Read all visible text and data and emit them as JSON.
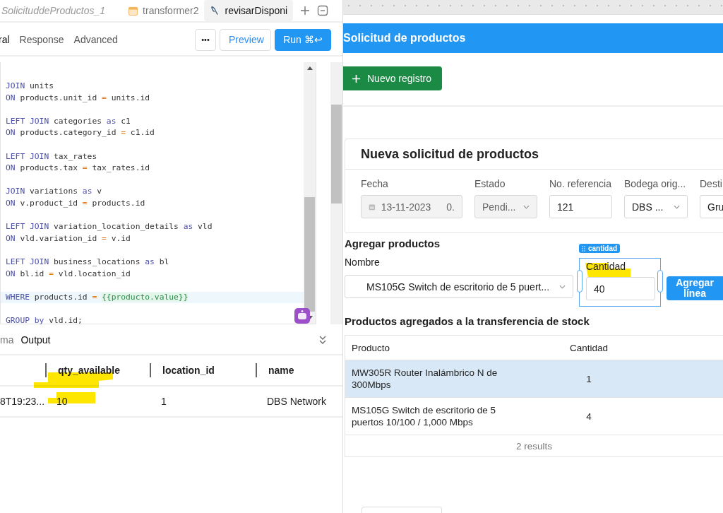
{
  "editor_tabs": [
    {
      "label": "SolicituddeProductos_1",
      "selected": false
    },
    {
      "label": "transformer2",
      "selected": false
    },
    {
      "label": "revisarDisponi",
      "selected": true
    }
  ],
  "query_tabs": [
    {
      "label": "ral",
      "selected": true
    },
    {
      "label": "Response",
      "selected": false
    },
    {
      "label": "Advanced",
      "selected": false
    }
  ],
  "toolbar": {
    "more": "•••",
    "preview": "Preview",
    "run": "Run ⌘↩"
  },
  "code": {
    "blocks": [
      {
        "lines": [
          {
            "highlighted": false,
            "tokens": [
              {
                "kind": "kw",
                "text": "JOIN"
              },
              {
                "kind": "id",
                "text": "units"
              }
            ]
          },
          {
            "highlighted": false,
            "tokens": [
              {
                "kind": "kw",
                "text": "ON"
              },
              {
                "kind": "id",
                "text": "products.unit_id"
              },
              {
                "kind": "op",
                "text": "="
              },
              {
                "kind": "id",
                "text": "units.id"
              }
            ]
          }
        ]
      },
      {
        "lines": [
          {
            "highlighted": false,
            "tokens": [
              {
                "kind": "kw",
                "text": "LEFT JOIN"
              },
              {
                "kind": "id",
                "text": "categories"
              },
              {
                "kind": "kw",
                "text": "as"
              },
              {
                "kind": "id",
                "text": "c1"
              }
            ]
          },
          {
            "highlighted": false,
            "tokens": [
              {
                "kind": "kw",
                "text": "ON"
              },
              {
                "kind": "id",
                "text": "products.category_id"
              },
              {
                "kind": "op",
                "text": "="
              },
              {
                "kind": "id",
                "text": "c1.id"
              }
            ]
          }
        ]
      },
      {
        "lines": [
          {
            "highlighted": false,
            "tokens": [
              {
                "kind": "kw",
                "text": "LEFT JOIN"
              },
              {
                "kind": "id",
                "text": "tax_rates"
              }
            ]
          },
          {
            "highlighted": false,
            "tokens": [
              {
                "kind": "kw",
                "text": "ON"
              },
              {
                "kind": "id",
                "text": "products.tax"
              },
              {
                "kind": "op",
                "text": "="
              },
              {
                "kind": "id",
                "text": "tax_rates.id"
              }
            ]
          }
        ]
      },
      {
        "lines": [
          {
            "highlighted": false,
            "tokens": [
              {
                "kind": "kw",
                "text": "JOIN"
              },
              {
                "kind": "id",
                "text": "variations"
              },
              {
                "kind": "kw",
                "text": "as"
              },
              {
                "kind": "id",
                "text": "v"
              }
            ]
          },
          {
            "highlighted": false,
            "tokens": [
              {
                "kind": "kw",
                "text": "ON"
              },
              {
                "kind": "id",
                "text": "v.product_id"
              },
              {
                "kind": "op",
                "text": "="
              },
              {
                "kind": "id",
                "text": "products.id"
              }
            ]
          }
        ]
      },
      {
        "lines": [
          {
            "highlighted": false,
            "tokens": [
              {
                "kind": "kw",
                "text": "LEFT JOIN"
              },
              {
                "kind": "id",
                "text": "variation_location_details"
              },
              {
                "kind": "kw",
                "text": "as"
              },
              {
                "kind": "id",
                "text": "vld"
              }
            ]
          },
          {
            "highlighted": false,
            "tokens": [
              {
                "kind": "kw",
                "text": "ON"
              },
              {
                "kind": "id",
                "text": "vld.variation_id"
              },
              {
                "kind": "op",
                "text": "="
              },
              {
                "kind": "id",
                "text": "v.id"
              }
            ]
          }
        ]
      },
      {
        "lines": [
          {
            "highlighted": false,
            "tokens": [
              {
                "kind": "kw",
                "text": "LEFT JOIN"
              },
              {
                "kind": "id",
                "text": "business_locations"
              },
              {
                "kind": "kw",
                "text": "as"
              },
              {
                "kind": "id",
                "text": "bl"
              }
            ]
          },
          {
            "highlighted": false,
            "tokens": [
              {
                "kind": "kw",
                "text": "ON"
              },
              {
                "kind": "id",
                "text": "bl.id"
              },
              {
                "kind": "op",
                "text": "="
              },
              {
                "kind": "id",
                "text": "vld.location_id"
              }
            ]
          }
        ]
      },
      {
        "lines": [
          {
            "highlighted": true,
            "tokens": [
              {
                "kind": "kw",
                "text": "WHERE"
              },
              {
                "kind": "id",
                "text": "products.id"
              },
              {
                "kind": "op",
                "text": "="
              },
              {
                "kind": "tpl",
                "text": "{{producto.value}}"
              }
            ]
          }
        ]
      },
      {
        "lines": [
          {
            "highlighted": false,
            "tokens": [
              {
                "kind": "kw",
                "text": "GROUP"
              },
              {
                "kind": "kw",
                "text": "by"
              },
              {
                "kind": "id",
                "text": "vld.id;"
              }
            ]
          }
        ]
      }
    ]
  },
  "output_tabs": [
    {
      "label": "ma",
      "selected": false
    },
    {
      "label": "Output",
      "selected": true
    }
  ],
  "output_table": {
    "columns": [
      "",
      "qty_available",
      "location_id",
      "name"
    ],
    "rows": [
      [
        "8T19:23...",
        "10",
        "1",
        "DBS Network"
      ]
    ]
  },
  "app": {
    "header": "Solicitud de productos",
    "new_button": "Nuevo registro",
    "form": {
      "title": "Nueva solicitud de productos",
      "fields": [
        {
          "kind": "date",
          "label": "Fecha",
          "value": "13-11-2023",
          "extra": "0.",
          "disabled": true
        },
        {
          "kind": "select",
          "label": "Estado",
          "value": "Pendi...",
          "disabled": true
        },
        {
          "kind": "input",
          "label": "No. referencia",
          "value": "121",
          "disabled": false
        },
        {
          "kind": "select",
          "label": "Bodega orig...",
          "value": "DBS ...",
          "disabled": false
        },
        {
          "kind": "select",
          "label": "Desti",
          "value": "Gru",
          "disabled": false
        }
      ]
    },
    "add": {
      "title": "Agregar productos",
      "name_label": "Nombre",
      "name_value": "MS105G Switch de escritorio de 5 puert...",
      "qty_badge": "cantidad",
      "qty_label": "Cantidad",
      "qty_value": "40",
      "button": "Agregar línea"
    },
    "table": {
      "title": "Productos agregados a la transferencia de stock",
      "columns": [
        "Producto",
        "Cantidad"
      ],
      "rows": [
        {
          "product": "MW305R Router Inalámbrico N de 300Mbps",
          "qty": "1",
          "selected": true
        },
        {
          "product": "MS105G Switch de escritorio de 5 puertos 10/100 / 1,000 Mbps",
          "qty": "4",
          "selected": false
        }
      ],
      "footer": "2 results"
    }
  }
}
